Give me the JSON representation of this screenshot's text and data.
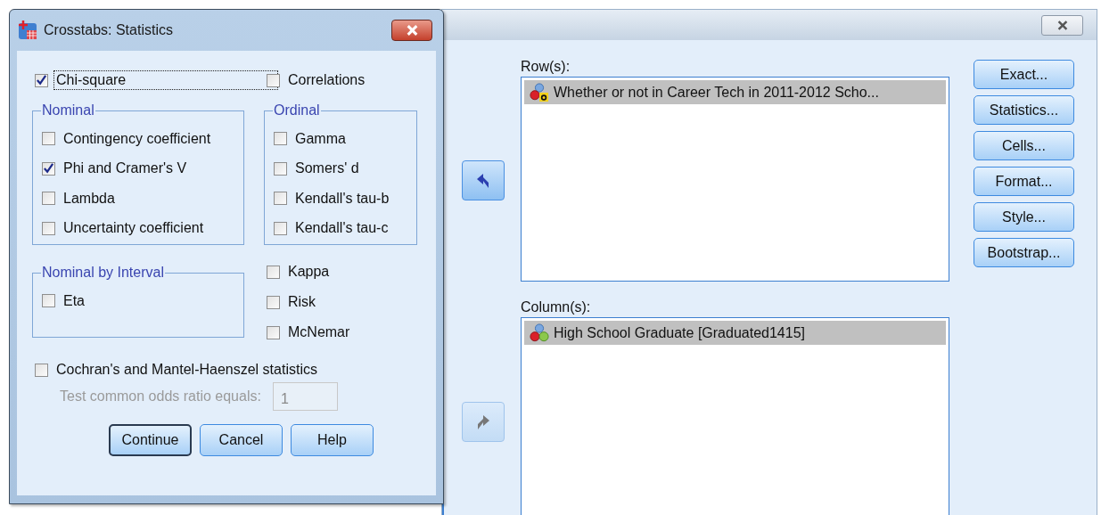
{
  "dialog": {
    "title": "Crosstabs: Statistics",
    "top_options": [
      {
        "label": "Chi-square",
        "checked": true,
        "focused": true
      },
      {
        "label": "Correlations",
        "checked": false,
        "focused": false
      }
    ],
    "groups": [
      {
        "title": "Nominal",
        "options": [
          {
            "label": "Contingency coefficient",
            "checked": false
          },
          {
            "label": "Phi and Cramer's V",
            "checked": true
          },
          {
            "label": "Lambda",
            "checked": false
          },
          {
            "label": "Uncertainty coefficient",
            "checked": false
          }
        ]
      },
      {
        "title": "Ordinal",
        "options": [
          {
            "label": "Gamma",
            "checked": false
          },
          {
            "label": "Somers' d",
            "checked": false
          },
          {
            "label": "Kendall's tau-b",
            "checked": false
          },
          {
            "label": "Kendall's tau-c",
            "checked": false
          }
        ]
      },
      {
        "title": "Nominal by Interval",
        "options": [
          {
            "label": "Eta",
            "checked": false
          }
        ]
      }
    ],
    "extra_options": [
      {
        "label": "Kappa",
        "checked": false
      },
      {
        "label": "Risk",
        "checked": false
      },
      {
        "label": "McNemar",
        "checked": false
      }
    ],
    "cmh": {
      "label": "Cochran's and Mantel-Haenszel statistics",
      "checked": false
    },
    "odds_ratio": {
      "label": "Test common odds ratio equals:",
      "value": "1",
      "disabled": true
    },
    "buttons": [
      {
        "label": "Continue",
        "default": true
      },
      {
        "label": "Cancel",
        "default": false
      },
      {
        "label": "Help",
        "default": false
      }
    ]
  },
  "main_window": {
    "lists": [
      {
        "label": "Row(s):",
        "arrow": {
          "kind": "left",
          "disabled": false
        },
        "variables": [
          {
            "label": "Whether or not in Career Tech in 2011-2012 Scho...",
            "kind": "string",
            "selected": true
          }
        ]
      },
      {
        "label": "Column(s):",
        "arrow": {
          "kind": "right",
          "disabled": true
        },
        "variables": [
          {
            "label": "High School Graduate [Graduated1415]",
            "kind": "nominal",
            "selected": true
          }
        ]
      }
    ],
    "buttons": [
      {
        "label": "Exact..."
      },
      {
        "label": "Statistics..."
      },
      {
        "label": "Cells..."
      },
      {
        "label": "Format..."
      },
      {
        "label": "Style..."
      },
      {
        "label": "Bootstrap..."
      }
    ]
  }
}
